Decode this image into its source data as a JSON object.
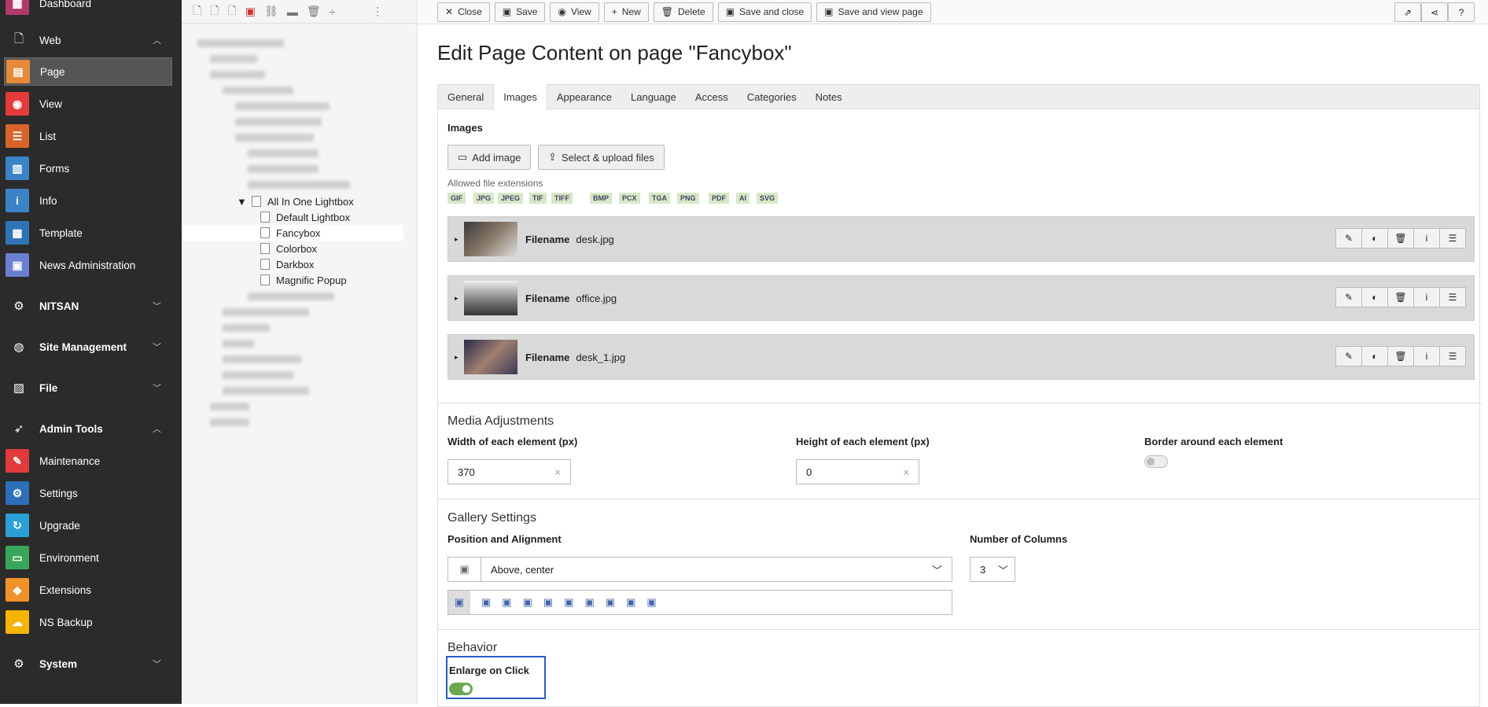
{
  "modules": {
    "dashboard": "Dashboard",
    "web": "Web",
    "page": "Page",
    "view": "View",
    "list": "List",
    "forms": "Forms",
    "info": "Info",
    "template": "Template",
    "news": "News Administration",
    "nitsan": "NITSAN",
    "site": "Site Management",
    "file": "File",
    "admin": "Admin Tools",
    "maintenance": "Maintenance",
    "settings": "Settings",
    "upgrade": "Upgrade",
    "environment": "Environment",
    "extensions": "Extensions",
    "nsbackup": "NS Backup",
    "system": "System"
  },
  "tree": {
    "parent": "All In One Lightbox",
    "items": [
      "Default Lightbox",
      "Fancybox",
      "Colorbox",
      "Darkbox",
      "Magnific Popup"
    ]
  },
  "toolbar": {
    "close": "Close",
    "save": "Save",
    "view": "View",
    "new": "New",
    "delete": "Delete",
    "save_close": "Save and close",
    "save_view": "Save and view page"
  },
  "title": "Edit Page Content on page \"Fancybox\"",
  "tabs": [
    "General",
    "Images",
    "Appearance",
    "Language",
    "Access",
    "Categories",
    "Notes"
  ],
  "images": {
    "heading": "Images",
    "add_image": "Add image",
    "select_upload": "Select & upload files",
    "allowed_label": "Allowed file extensions",
    "extensions": [
      "GIF",
      "JPG",
      "JPEG",
      "TIF",
      "TIFF",
      "BMP",
      "PCX",
      "TGA",
      "PNG",
      "PDF",
      "AI",
      "SVG"
    ],
    "filename_label": "Filename",
    "files": [
      "desk.jpg",
      "office.jpg",
      "desk_1.jpg"
    ]
  },
  "media": {
    "heading": "Media Adjustments",
    "width_label": "Width of each element (px)",
    "width_value": "370",
    "height_label": "Height of each element (px)",
    "height_value": "0",
    "border_label": "Border around each element"
  },
  "gallery": {
    "heading": "Gallery Settings",
    "position_label": "Position and Alignment",
    "position_value": "Above, center",
    "columns_label": "Number of Columns",
    "columns_value": "3"
  },
  "behavior": {
    "heading": "Behavior",
    "enlarge_label": "Enlarge on Click"
  },
  "colors": {
    "page": "#e68a3a",
    "view": "#e33a3a",
    "list": "#d9642b",
    "forms": "#3b82c6",
    "info": "#3b82c6",
    "template": "#2f74b5",
    "news": "#6b7fd0",
    "maintenance": "#e03a3a",
    "settings": "#2d6fb8",
    "upgrade": "#2aa0d6",
    "environment": "#3aa65b",
    "extensions": "#f0922a",
    "nsbackup": "#f4b400",
    "focus": "#2b5cc9",
    "toggle_on": "#6aa84f"
  }
}
